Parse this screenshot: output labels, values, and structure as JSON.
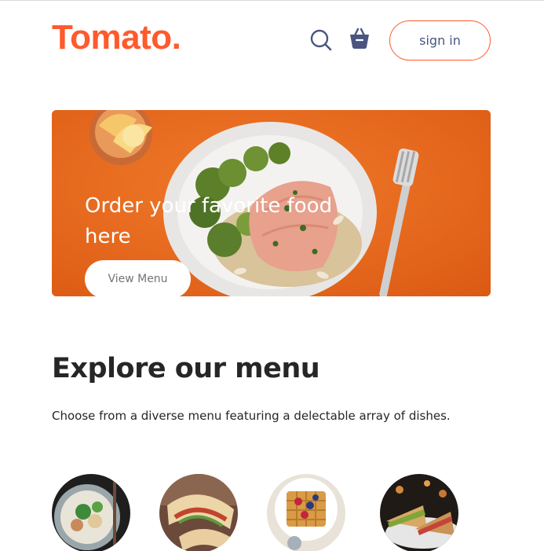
{
  "header": {
    "logo": "Tomato.",
    "search_icon": "search-icon",
    "basket_icon": "basket-icon",
    "signin_label": "sign in",
    "brand_color": "#ff5a2c",
    "accent_text_color": "#49557e"
  },
  "hero": {
    "title": "Order your favorite food here",
    "button_label": "View Menu",
    "background_color": "#ec6a20"
  },
  "explore": {
    "title": "Explore our menu",
    "description": "Choose from a diverse menu featuring a delectable array of dishes."
  },
  "menu_items": [
    {
      "image": "noodle-bowl-image"
    },
    {
      "image": "wrap-roll-image"
    },
    {
      "image": "waffle-berries-image"
    },
    {
      "image": "sandwich-image"
    }
  ]
}
